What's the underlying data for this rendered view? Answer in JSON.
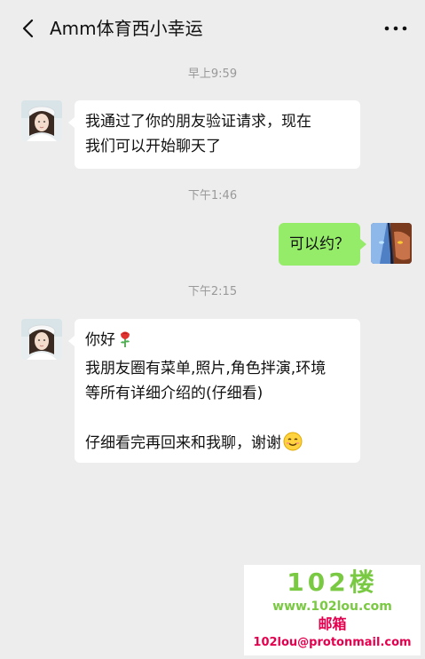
{
  "header": {
    "title": "Amm体育西小幸运",
    "back_icon": "chevron-left-icon",
    "more_icon": "ellipsis-icon"
  },
  "messages": [
    {
      "time": "早上9:59"
    },
    {
      "side": "left",
      "lines": [
        "我通过了你的朋友验证请求，现在",
        "我们可以开始聊天了"
      ]
    },
    {
      "time": "下午1:46"
    },
    {
      "side": "right",
      "lines": [
        "可以约？"
      ]
    },
    {
      "time": "下午2:15"
    },
    {
      "side": "left",
      "lines": [
        "你好",
        "我朋友圈有菜单,照片,角色拌演,环境",
        "等所有详细介绍的(仔细看)",
        "",
        "仔细看完再回来和我聊，谢谢"
      ],
      "emojis": [
        "rose-emoji",
        "smile-emoji"
      ]
    }
  ],
  "watermark": {
    "big": "102楼",
    "url": "www.102lou.com",
    "mail_label": "邮箱",
    "mail": "102lou@protonmail.com"
  },
  "colors": {
    "background": "#ededed",
    "bubble_self": "#95ec69",
    "bubble_other": "#ffffff",
    "timestamp": "#999999"
  }
}
